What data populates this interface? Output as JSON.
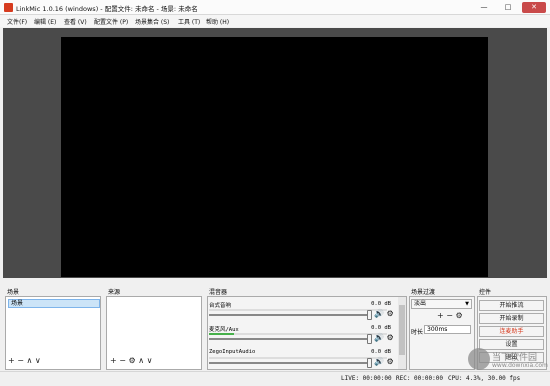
{
  "window": {
    "title": "LinkMic 1.0.16 (windows) - 配置文件: 未命名 - 场景: 未命名",
    "minimize_icon": "minimize-icon",
    "maximize_icon": "maximize-icon",
    "close_icon": "close-icon",
    "minimize_glyph": "—",
    "maximize_glyph": "□",
    "close_glyph": "✕"
  },
  "menu": [
    "文件(F)",
    "编辑 (E)",
    "查看 (V)",
    "配置文件 (P)",
    "场景集合 (S)",
    "工具 (T)",
    "帮助 (H)"
  ],
  "docks": {
    "scenes": {
      "title": "场景",
      "items": [
        "场景"
      ],
      "toolbar": "+ − ∧ ∨"
    },
    "sources": {
      "title": "来源",
      "toolbar": "+ − ⚙ ∧ ∨"
    },
    "mixer": {
      "title": "混音器",
      "channels": [
        {
          "name": "台式音响",
          "db": "0.0 dB",
          "level": 0.0
        },
        {
          "name": "麦克风/Aux",
          "db": "0.0 dB",
          "level": 0.14
        },
        {
          "name": "ZegoInputAudio",
          "db": "0.0 dB",
          "level": 0.0
        }
      ],
      "speaker_glyph": "🔊",
      "gear_glyph": "⚙"
    },
    "transitions": {
      "title": "场景过渡",
      "selected": "淡出",
      "toolbar": "+ − ⚙",
      "duration_label": "时长",
      "duration_value": "300ms"
    },
    "controls": {
      "title": "控件",
      "buttons": [
        "开始推流",
        "开始录制",
        "连麦助手",
        "设置",
        "退出"
      ]
    }
  },
  "status": {
    "live": "LIVE: 00:00:00",
    "rec": "REC: 00:00:00",
    "cpu": "CPU: 4.3%, 30.00 fps"
  },
  "watermark": {
    "line1": "当下软件园",
    "line2": "www.downxia.com"
  },
  "colors": {
    "accent_red": "#d63b1f",
    "meter_green": "#46b04a",
    "selection_blue": "#cce4f7"
  }
}
